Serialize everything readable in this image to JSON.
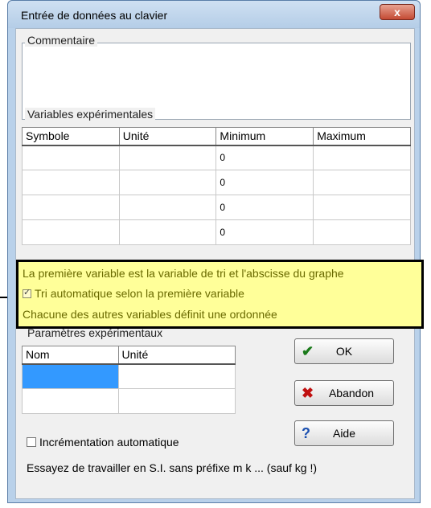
{
  "window": {
    "title": "Entrée de données au clavier",
    "close_glyph": "x"
  },
  "commentaire": {
    "label": "Commentaire",
    "value": ""
  },
  "variables": {
    "label": "Variables expérimentales",
    "columns": [
      "Symbole",
      "Unité",
      "Minimum",
      "Maximum"
    ],
    "rows": [
      [
        "",
        "",
        "0",
        ""
      ],
      [
        "",
        "",
        "0",
        ""
      ],
      [
        "",
        "",
        "0",
        ""
      ],
      [
        "",
        "",
        "0",
        ""
      ]
    ]
  },
  "note": {
    "line1": "La première variable est la variable de tri et l'abscisse du graphe",
    "tri_label": "Tri automatique selon la première variable",
    "tri_checked": true,
    "line3": "Chacune des autres variables définit une ordonnée"
  },
  "parametres": {
    "label": "Paramètres expérimentaux",
    "columns": [
      "Nom",
      "Unité"
    ],
    "rows": [
      [
        "",
        ""
      ],
      [
        "",
        ""
      ]
    ]
  },
  "buttons": {
    "ok": {
      "label": "OK",
      "icon": "check-icon",
      "color": "#1a7a1a"
    },
    "abandon": {
      "label": "Abandon",
      "icon": "cross-icon",
      "color": "#c01010"
    },
    "aide": {
      "label": "Aide",
      "icon": "question-icon",
      "color": "#1a4fb0"
    }
  },
  "increment": {
    "label": "Incrémentation automatique",
    "checked": false
  },
  "hint": "Essayez de travailler en S.I. sans préfixe m k ... (sauf kg !)"
}
